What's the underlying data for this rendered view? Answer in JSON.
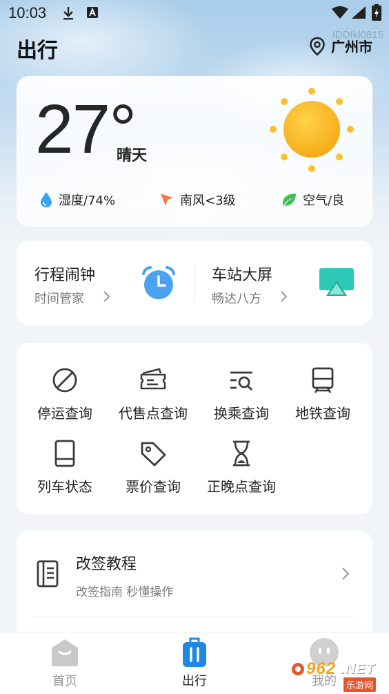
{
  "status_bar": {
    "time": "10:03"
  },
  "watermark_id": "IDDIkl0815",
  "header": {
    "title": "出行",
    "location": "广州市"
  },
  "weather": {
    "temperature": "27°",
    "condition": "晴天",
    "humidity": "湿度/74%",
    "wind": "南风<3级",
    "air": "空气/良"
  },
  "shortcuts": [
    {
      "title": "行程闹钟",
      "subtitle": "时间管家",
      "icon": "alarm-clock-icon"
    },
    {
      "title": "车站大屏",
      "subtitle": "畅达八方",
      "icon": "station-screen-icon"
    }
  ],
  "services": [
    {
      "label": "停运查询",
      "icon": "prohibited-icon"
    },
    {
      "label": "代售点查询",
      "icon": "ticket-icon"
    },
    {
      "label": "换乘查询",
      "icon": "list-search-icon"
    },
    {
      "label": "地铁查询",
      "icon": "metro-icon"
    },
    {
      "label": "列车状态",
      "icon": "tablet-icon"
    },
    {
      "label": "票价查询",
      "icon": "price-tag-icon"
    },
    {
      "label": "正晚点查询",
      "icon": "hourglass-icon"
    }
  ],
  "guide": {
    "title": "改签教程",
    "subtitle": "改签指南 秒懂操作",
    "icon": "notebook-icon"
  },
  "bottom_nav": [
    {
      "label": "首页",
      "icon": "home-icon",
      "active": false
    },
    {
      "label": "出行",
      "icon": "luggage-icon",
      "active": true
    },
    {
      "label": "我的",
      "icon": "profile-face-icon",
      "active": false
    }
  ],
  "brand_watermark": {
    "number": "962",
    "domain": ".NET",
    "site": "乐游网"
  },
  "colors": {
    "accent": "#1e88e5",
    "sun": "#fbc02d",
    "teal": "#26c6b2",
    "inactive": "#b5b5b5"
  }
}
